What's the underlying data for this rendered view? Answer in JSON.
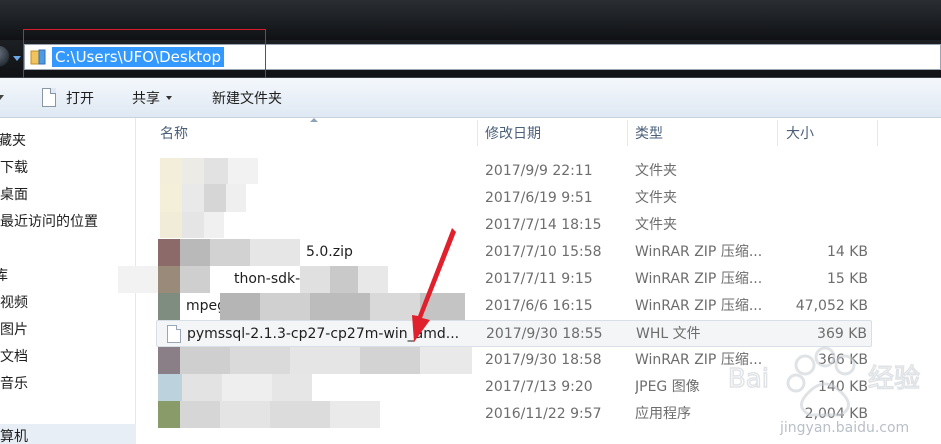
{
  "address_bar": {
    "path": "C:\\Users\\UFO\\Desktop"
  },
  "toolbar": {
    "open_label": "打开",
    "share_label": "共享",
    "new_folder_label": "新建文件夹"
  },
  "sidebar": {
    "items": [
      {
        "label": "藏夹"
      },
      {
        "label": "下载"
      },
      {
        "label": "桌面"
      },
      {
        "label": "最近访问的位置"
      },
      {
        "label": "库"
      },
      {
        "label": "视频"
      },
      {
        "label": "图片"
      },
      {
        "label": "文档"
      },
      {
        "label": "音乐"
      },
      {
        "label": "算机"
      }
    ]
  },
  "columns": {
    "name": "名称",
    "date": "修改日期",
    "type": "类型",
    "size": "大小"
  },
  "files": [
    {
      "name": "",
      "date": "2017/9/9 22:11",
      "type": "文件夹",
      "size": ""
    },
    {
      "name": "",
      "date": "2017/6/19 9:51",
      "type": "文件夹",
      "size": ""
    },
    {
      "name": "",
      "date": "2017/7/14 18:15",
      "type": "文件夹",
      "size": ""
    },
    {
      "name": "5.0.zip",
      "date": "2017/7/10 15:58",
      "type": "WinRAR ZIP 压缩...",
      "size": "14 KB"
    },
    {
      "name": "thon-sdk-1",
      "date": "2017/7/11 9:15",
      "type": "WinRAR ZIP 压缩...",
      "size": "15 KB"
    },
    {
      "name": "mpeg",
      "date": "2017/6/6 16:15",
      "type": "WinRAR ZIP 压缩...",
      "size": "47,052 KB"
    },
    {
      "name": "pymssql-2.1.3-cp27-cp27m-win_amd...",
      "date": "2017/9/30 18:55",
      "type": "WHL 文件",
      "size": "369 KB"
    },
    {
      "name": "",
      "date": "2017/9/30 18:58",
      "type": "WinRAR ZIP 压缩...",
      "size": "366 KB"
    },
    {
      "name": "",
      "date": "2017/7/13 9:20",
      "type": "JPEG 图像",
      "size": "140 KB"
    },
    {
      "name": "",
      "date": "2016/11/22 9:57",
      "type": "应用程序",
      "size": "2,004 KB"
    }
  ],
  "watermark": {
    "text": "jingyan.baidu.com"
  },
  "colors": {
    "selection": "#3399ff",
    "annotation_red": "#d81b2a",
    "header_text": "#4c607a"
  }
}
